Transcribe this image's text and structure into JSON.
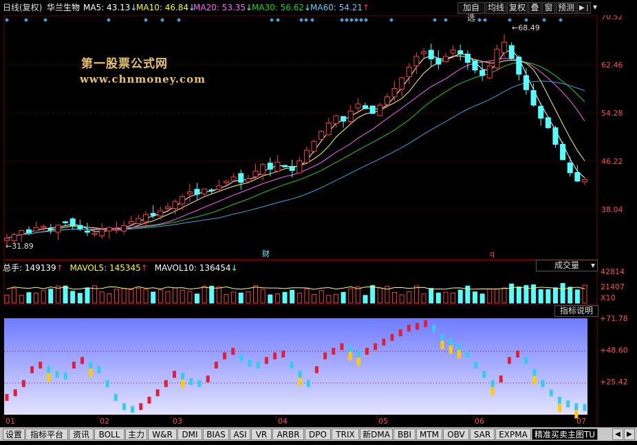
{
  "header": {
    "period": "日线(复权)",
    "stock_name": "华兰生物",
    "ma5": {
      "label": "MA5: 43.13",
      "arrow": "↓",
      "color": "#ffffff"
    },
    "ma10": {
      "label": "MA10: 46.84",
      "arrow": "↓",
      "color": "#ffff00"
    },
    "ma20": {
      "label": "MA20: 53.35",
      "arrow": "↓",
      "color": "#ff66ff"
    },
    "ma30": {
      "label": "MA30: 56.62",
      "arrow": "↓",
      "color": "#00e000"
    },
    "ma60": {
      "label": "MA60: 54.21",
      "arrow": "↑",
      "color": "#66ccff"
    },
    "buttons": [
      "加自选",
      "均线",
      "复权",
      "叠",
      "窗",
      "预测"
    ],
    "nav_icon": "play-end-icon"
  },
  "price_axis": [
    "70.52",
    "62.46",
    "54.28",
    "46.22",
    "38.04"
  ],
  "annotations": {
    "high": "68.49",
    "low": "31.89",
    "marker_cai": "财",
    "marker_q": "q"
  },
  "watermark": {
    "line1": "第一股票公式网",
    "line2": "www.chnmoney.com"
  },
  "volume_panel": {
    "total": "总手: 149139",
    "total_arrow": "↑",
    "mavol5": "MAVOL5: 145345",
    "mavol5_arrow": "↑",
    "mavol10": "MAVOL10: 136454",
    "mavol10_arrow": "↓",
    "select_label": "成交量",
    "axis": [
      "42814",
      "21407",
      "X10"
    ]
  },
  "indicator_panel": {
    "help_button": "指标说明",
    "axis": [
      "+71.78",
      "+48.60",
      "+25.42"
    ]
  },
  "x_axis": [
    "01",
    "02",
    "03",
    "04",
    "05",
    "06",
    "07"
  ],
  "tabs": [
    "设置",
    "指标平台",
    "资讯",
    "BOLL",
    "主力",
    "W&R",
    "DMI",
    "BIAS",
    "ASI",
    "VR",
    "ARBR",
    "DPO",
    "TRIX",
    "新DMA",
    "BBI",
    "MTM",
    "OBV",
    "SAR",
    "EXPMA",
    "精准买卖主图TU"
  ],
  "active_tab": "精准买卖主图TU",
  "colors": {
    "up": "#ff3c3c",
    "down": "#54ffff",
    "grid": "#8b0000",
    "axis_text": "#ff4b4b",
    "indicator_bg_top": "#7080ff",
    "indicator_bg_bottom": "#dcdcff"
  },
  "chart_data": {
    "type": "candlestick",
    "ylim": [
      31.89,
      70.52
    ],
    "close_path": [
      33.2,
      33.8,
      34.5,
      34.1,
      35.0,
      35.2,
      34.6,
      35.4,
      35.9,
      35.3,
      34.8,
      34.2,
      34.0,
      34.6,
      35.0,
      34.7,
      35.3,
      36.0,
      36.5,
      37.2,
      37.0,
      37.8,
      38.5,
      39.4,
      40.2,
      41.0,
      40.6,
      41.5,
      41.2,
      42.0,
      42.8,
      43.5,
      42.6,
      43.2,
      44.5,
      45.6,
      44.8,
      46.0,
      45.2,
      44.6,
      46.2,
      48.0,
      49.5,
      51.2,
      52.6,
      53.8,
      52.9,
      54.6,
      55.8,
      55.0,
      54.2,
      55.6,
      57.0,
      58.4,
      60.2,
      62.0,
      63.8,
      64.6,
      63.4,
      62.5,
      63.8,
      64.9,
      64.2,
      62.8,
      61.5,
      60.6,
      62.2,
      65.0,
      66.2,
      63.5,
      60.8,
      58.2,
      55.6,
      53.4,
      51.8,
      49.0,
      46.4,
      44.2,
      42.8,
      43.1
    ],
    "high": 68.49,
    "low": 31.89,
    "moving_averages": {
      "MA5": 43.13,
      "MA10": 46.84,
      "MA20": 53.35,
      "MA30": 56.62,
      "MA60": 54.21
    },
    "volume": {
      "total": 149139,
      "MAVOL5": 145345,
      "MAVOL10": 136454,
      "axis_max": 42814,
      "unit": "X10"
    },
    "indicator_axis": [
      71.78,
      48.6,
      25.42
    ],
    "x_labels": [
      "01",
      "02",
      "03",
      "04",
      "05",
      "06",
      "07"
    ]
  }
}
